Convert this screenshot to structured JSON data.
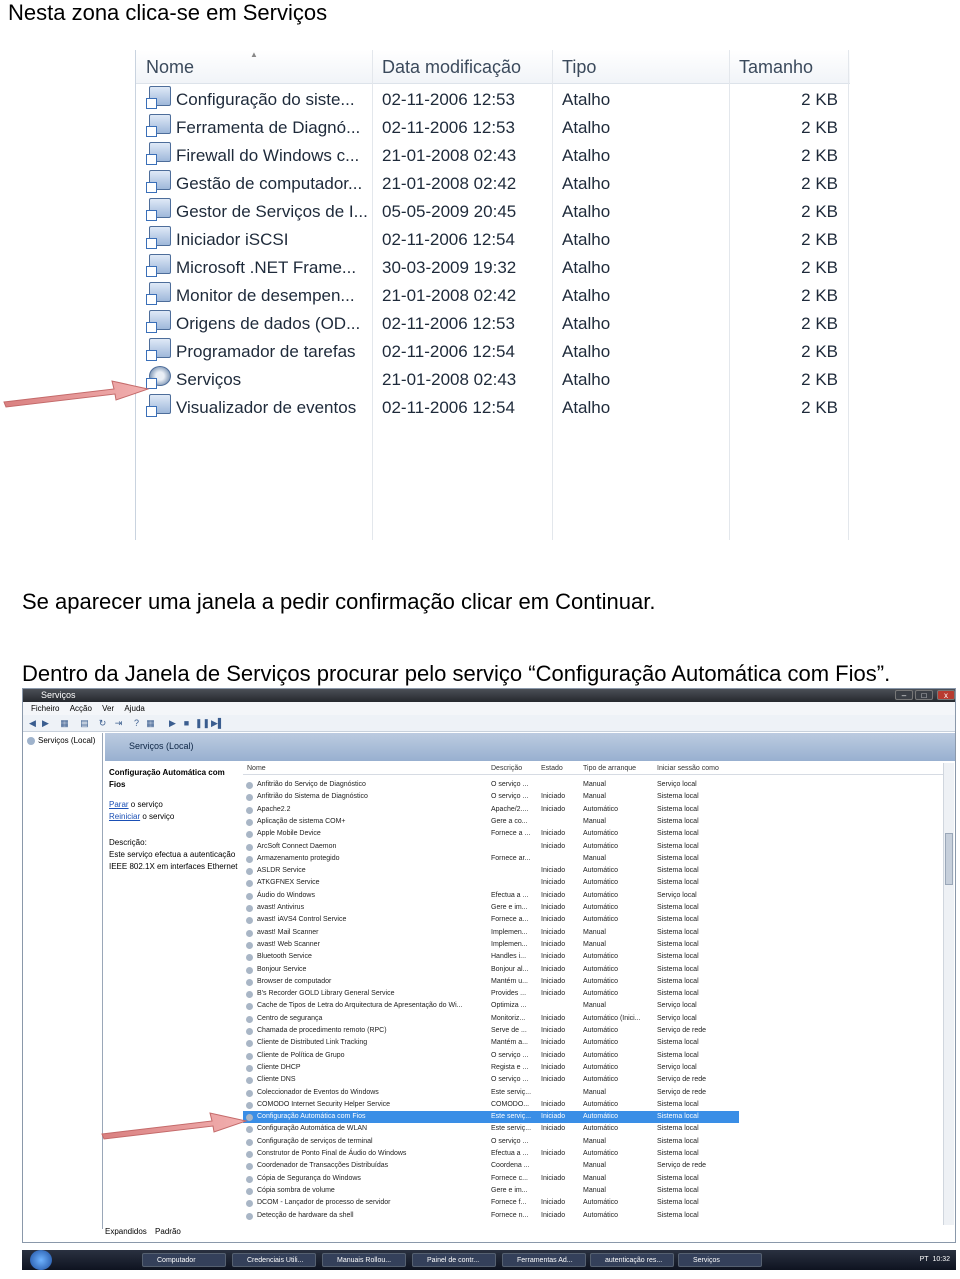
{
  "doc": {
    "line1": "Nesta zona clica-se em Serviços",
    "line2": "Se aparecer uma janela a pedir confirmação clicar em Continuar.",
    "line3": "Dentro da Janela de Serviços procurar pelo serviço “Configuração Automática com Fios”."
  },
  "explorer": {
    "columns": [
      "Nome",
      "Data modificação",
      "Tipo",
      "Tamanho"
    ],
    "rows": [
      {
        "name": "Configuração do siste...",
        "date": "02-11-2006 12:53",
        "type": "Atalho",
        "size": "2 KB"
      },
      {
        "name": "Ferramenta de Diagnó...",
        "date": "02-11-2006 12:53",
        "type": "Atalho",
        "size": "2 KB"
      },
      {
        "name": "Firewall do Windows c...",
        "date": "21-01-2008 02:43",
        "type": "Atalho",
        "size": "2 KB"
      },
      {
        "name": "Gestão de computador...",
        "date": "21-01-2008 02:42",
        "type": "Atalho",
        "size": "2 KB"
      },
      {
        "name": "Gestor de Serviços de I...",
        "date": "05-05-2009 20:45",
        "type": "Atalho",
        "size": "2 KB"
      },
      {
        "name": "Iniciador iSCSI",
        "date": "02-11-2006 12:54",
        "type": "Atalho",
        "size": "2 KB"
      },
      {
        "name": "Microsoft .NET Frame...",
        "date": "30-03-2009 19:32",
        "type": "Atalho",
        "size": "2 KB"
      },
      {
        "name": "Monitor de desempen...",
        "date": "21-01-2008 02:42",
        "type": "Atalho",
        "size": "2 KB"
      },
      {
        "name": "Origens de dados (OD...",
        "date": "02-11-2006 12:53",
        "type": "Atalho",
        "size": "2 KB"
      },
      {
        "name": "Programador de tarefas",
        "date": "02-11-2006 12:54",
        "type": "Atalho",
        "size": "2 KB"
      },
      {
        "name": "Serviços",
        "date": "21-01-2008 02:43",
        "type": "Atalho",
        "size": "2 KB"
      },
      {
        "name": "Visualizador de eventos",
        "date": "02-11-2006 12:54",
        "type": "Atalho",
        "size": "2 KB"
      }
    ]
  },
  "services": {
    "window_title": "Serviços",
    "menu": [
      "Ficheiro",
      "Acção",
      "Ver",
      "Ajuda"
    ],
    "tree_node": "Serviços (Local)",
    "banner": "Serviços (Local)",
    "desc_title": "Configuração Automática com Fios",
    "desc_stop_link": "Parar",
    "desc_stop_rest": " o serviço",
    "desc_restart_link": "Reiniciar",
    "desc_restart_rest": " o serviço",
    "desc_label": "Descrição:",
    "desc_text": "Este serviço efectua a autenticação IEEE 802.1X em interfaces Ethernet",
    "columns": [
      "Nome",
      "Descrição",
      "Estado",
      "Tipo de arranque",
      "Iniciar sessão como"
    ],
    "tabs": [
      "Expandidos",
      "Padrão"
    ],
    "rows": [
      [
        "Anfitrião do Serviço de Diagnóstico",
        "O serviço ...",
        "",
        "Manual",
        "Serviço local"
      ],
      [
        "Anfitrião do Sistema de Diagnóstico",
        "O serviço ...",
        "Iniciado",
        "Manual",
        "Sistema local"
      ],
      [
        "Apache2.2",
        "Apache/2....",
        "Iniciado",
        "Automático",
        "Sistema local"
      ],
      [
        "Aplicação de sistema COM+",
        "Gere a co...",
        "",
        "Manual",
        "Sistema local"
      ],
      [
        "Apple Mobile Device",
        "Fornece a ...",
        "Iniciado",
        "Automático",
        "Sistema local"
      ],
      [
        "ArcSoft Connect Daemon",
        "",
        "Iniciado",
        "Automático",
        "Sistema local"
      ],
      [
        "Armazenamento protegido",
        "Fornece ar...",
        "",
        "Manual",
        "Sistema local"
      ],
      [
        "ASLDR Service",
        "",
        "Iniciado",
        "Automático",
        "Sistema local"
      ],
      [
        "ATKGFNEX Service",
        "",
        "Iniciado",
        "Automático",
        "Sistema local"
      ],
      [
        "Áudio do Windows",
        "Efectua a ...",
        "Iniciado",
        "Automático",
        "Serviço local"
      ],
      [
        "avast! Antivirus",
        "Gere e im...",
        "Iniciado",
        "Automático",
        "Sistema local"
      ],
      [
        "avast! iAVS4 Control Service",
        "Fornece a...",
        "Iniciado",
        "Automático",
        "Sistema local"
      ],
      [
        "avast! Mail Scanner",
        "Implemen...",
        "Iniciado",
        "Manual",
        "Sistema local"
      ],
      [
        "avast! Web Scanner",
        "Implemen...",
        "Iniciado",
        "Manual",
        "Sistema local"
      ],
      [
        "Bluetooth Service",
        "Handles i...",
        "Iniciado",
        "Automático",
        "Sistema local"
      ],
      [
        "Bonjour Service",
        "Bonjour al...",
        "Iniciado",
        "Automático",
        "Sistema local"
      ],
      [
        "Browser de computador",
        "Mantém u...",
        "Iniciado",
        "Automático",
        "Sistema local"
      ],
      [
        "B's Recorder GOLD Library General Service",
        "Provides ...",
        "Iniciado",
        "Automático",
        "Sistema local"
      ],
      [
        "Cache de Tipos de Letra do Arquitectura de Apresentação do Wi...",
        "Optimiza ...",
        "",
        "Manual",
        "Serviço local"
      ],
      [
        "Centro de segurança",
        "Monitoriz...",
        "Iniciado",
        "Automático (Inici...",
        "Serviço local"
      ],
      [
        "Chamada de procedimento remoto (RPC)",
        "Serve de ...",
        "Iniciado",
        "Automático",
        "Serviço de rede"
      ],
      [
        "Cliente de Distributed Link Tracking",
        "Mantém a...",
        "Iniciado",
        "Automático",
        "Sistema local"
      ],
      [
        "Cliente de Política de Grupo",
        "O serviço ...",
        "Iniciado",
        "Automático",
        "Sistema local"
      ],
      [
        "Cliente DHCP",
        "Regista e ...",
        "Iniciado",
        "Automático",
        "Serviço local"
      ],
      [
        "Cliente DNS",
        "O serviço ...",
        "Iniciado",
        "Automático",
        "Serviço de rede"
      ],
      [
        "Coleccionador de Eventos do Windows",
        "Este serviç...",
        "",
        "Manual",
        "Serviço de rede"
      ],
      [
        "COMODO Internet Security Helper Service",
        "COMODO...",
        "Iniciado",
        "Automático",
        "Sistema local"
      ],
      [
        "Configuração Automática com Fios",
        "Este serviç...",
        "Iniciado",
        "Automático",
        "Sistema local"
      ],
      [
        "Configuração Automática de WLAN",
        "Este serviç...",
        "Iniciado",
        "Automático",
        "Sistema local"
      ],
      [
        "Configuração de serviços de terminal",
        "O serviço ...",
        "",
        "Manual",
        "Sistema local"
      ],
      [
        "Construtor de Ponto Final de Áudio do Windows",
        "Efectua a ...",
        "Iniciado",
        "Automático",
        "Sistema local"
      ],
      [
        "Coordenador de Transacções Distribuídas",
        "Coordena ...",
        "",
        "Manual",
        "Serviço de rede"
      ],
      [
        "Cópia de Segurança do Windows",
        "Fornece c...",
        "Iniciado",
        "Manual",
        "Sistema local"
      ],
      [
        "Cópia sombra de volume",
        "Gere e im...",
        "",
        "Manual",
        "Sistema local"
      ],
      [
        "DCOM - Lançador de processo de servidor",
        "Fornece f...",
        "Iniciado",
        "Automático",
        "Sistema local"
      ],
      [
        "Detecção de hardware da shell",
        "Fornece n...",
        "Iniciado",
        "Automático",
        "Sistema local"
      ]
    ],
    "selected_index": 27
  },
  "taskbar": {
    "tasks": [
      "Computador",
      "Credenciais Utili...",
      "Manuais Rollou...",
      "Painel de contr...",
      "Ferramentas Ad...",
      "autenticação res...",
      "Serviços"
    ],
    "lang": "PT",
    "clock": "10:32"
  },
  "colors": {
    "selection": "#3a8ee6",
    "arrow": "#e58a8a"
  }
}
